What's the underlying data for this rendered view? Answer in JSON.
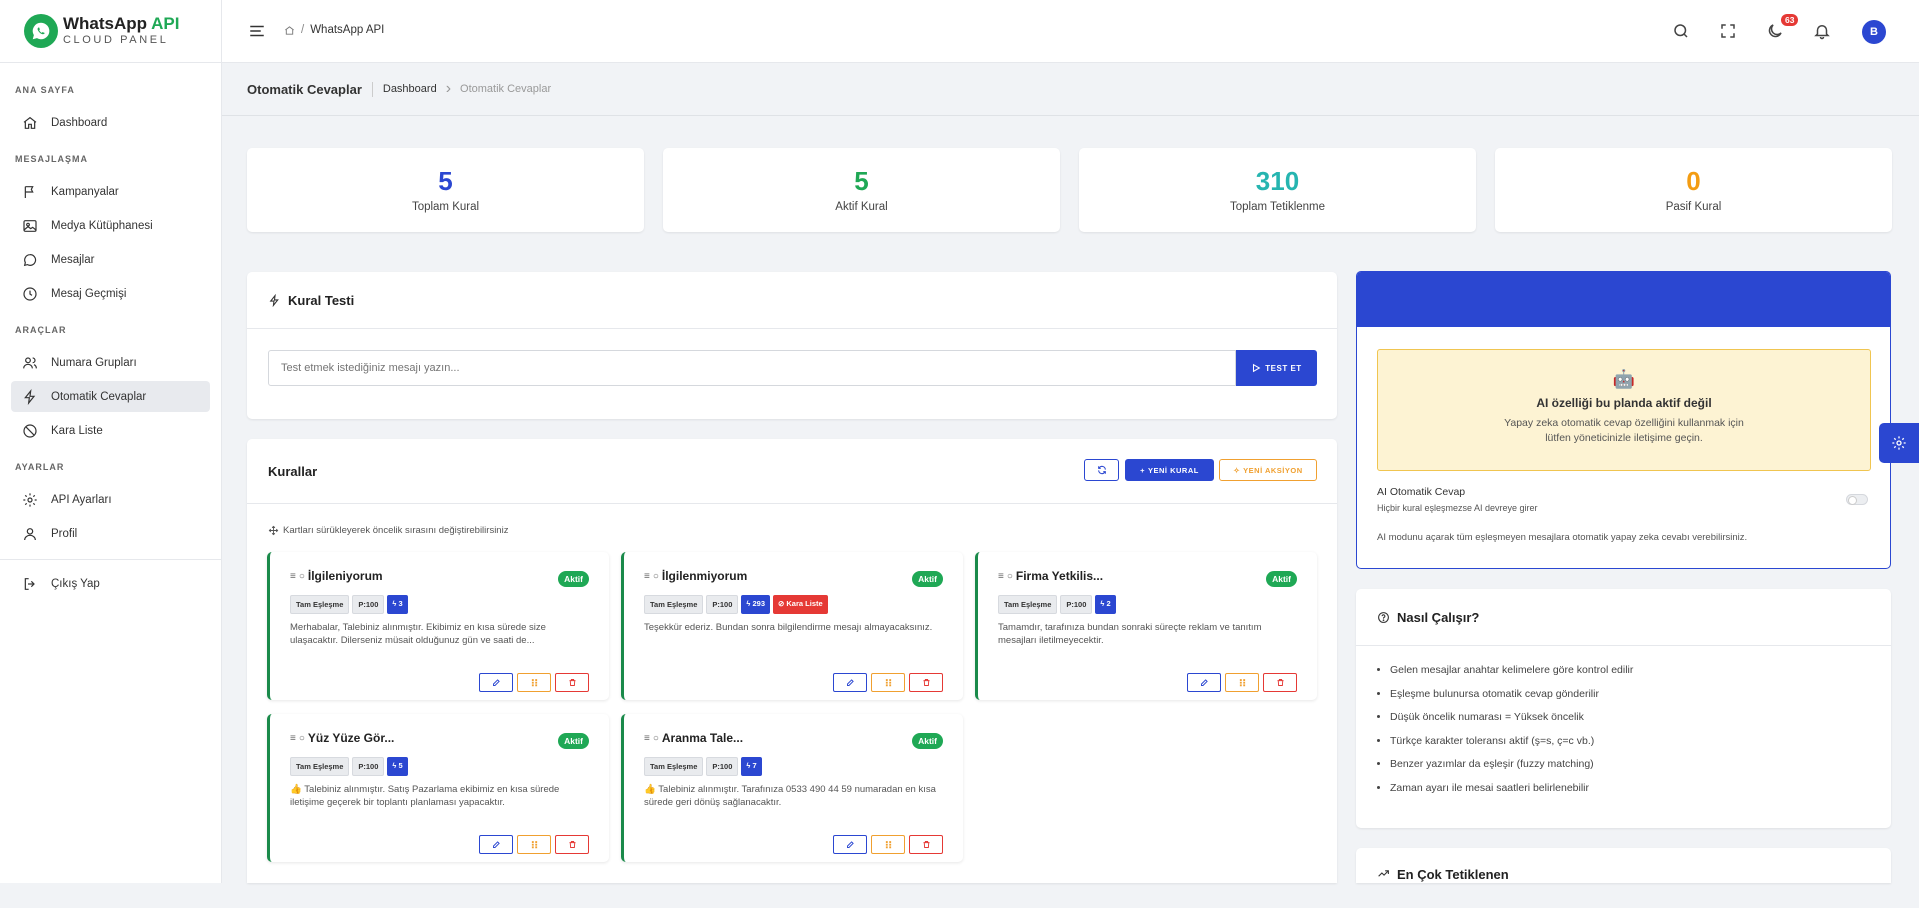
{
  "brand": {
    "title": "WhatsApp",
    "title_accent": "API",
    "subtitle": "CLOUD PANEL"
  },
  "sidebar": {
    "sections": [
      {
        "title": "ANA SAYFA",
        "items": [
          {
            "label": "Dashboard",
            "icon": "home-icon"
          }
        ]
      },
      {
        "title": "MESAJLAŞMA",
        "items": [
          {
            "label": "Kampanyalar",
            "icon": "flag-icon"
          },
          {
            "label": "Medya Kütüphanesi",
            "icon": "image-icon"
          },
          {
            "label": "Mesajlar",
            "icon": "chat-icon"
          },
          {
            "label": "Mesaj Geçmişi",
            "icon": "clock-icon"
          }
        ]
      },
      {
        "title": "ARAÇLAR",
        "items": [
          {
            "label": "Numara Grupları",
            "icon": "users-icon"
          },
          {
            "label": "Otomatik Cevaplar",
            "icon": "bolt-icon",
            "active": true
          },
          {
            "label": "Kara Liste",
            "icon": "ban-icon"
          }
        ]
      },
      {
        "title": "AYARLAR",
        "items": [
          {
            "label": "API Ayarları",
            "icon": "gear-icon"
          },
          {
            "label": "Profil",
            "icon": "user-icon"
          }
        ]
      }
    ],
    "logout": "Çıkış Yap"
  },
  "topbar": {
    "breadcrumb": "WhatsApp API",
    "notification_count": "63",
    "avatar_initial": "B"
  },
  "page": {
    "title": "Otomatik Cevaplar",
    "crumb_root": "Dashboard",
    "crumb_current": "Otomatik Cevaplar"
  },
  "stats": [
    {
      "value": "5",
      "label": "Toplam Kural",
      "color": "#2b47d1"
    },
    {
      "value": "5",
      "label": "Aktif Kural",
      "color": "#1fa855"
    },
    {
      "value": "310",
      "label": "Toplam Tetiklenme",
      "color": "#26b5b0"
    },
    {
      "value": "0",
      "label": "Pasif Kural",
      "color": "#f39c12"
    }
  ],
  "rule_test": {
    "title": "Kural Testi",
    "placeholder": "Test etmek istediğiniz mesajı yazın...",
    "button": "TEST ET"
  },
  "rules_panel": {
    "title": "Kurallar",
    "new_rule": "YENİ KURAL",
    "new_action": "YENİ AKSİYON",
    "hint": "Kartları sürükleyerek öncelik sırasını değiştirebilirsiniz"
  },
  "rules": [
    {
      "title": "İlgileniyorum",
      "status": "Aktif",
      "match": "Tam Eşleşme",
      "priority": "P:100",
      "count": "3",
      "text": "Merhabalar, Talebiniz alınmıştır. Ekibimiz en kısa sürede size ulaşacaktır. Dilerseniz müsait olduğunuz gün ve saati de..."
    },
    {
      "title": "İlgilenmiyorum",
      "status": "Aktif",
      "match": "Tam Eşleşme",
      "priority": "P:100",
      "count": "293",
      "blacklist": "Kara Liste",
      "text": "Teşekkür ederiz. Bundan sonra bilgilendirme mesajı almayacaksınız."
    },
    {
      "title": "Firma Yetkilis...",
      "status": "Aktif",
      "match": "Tam Eşleşme",
      "priority": "P:100",
      "count": "2",
      "text": "Tamamdır, tarafınıza bundan sonraki süreçte reklam ve tanıtım mesajları iletilmeyecektir."
    },
    {
      "title": "Yüz Yüze Gör...",
      "status": "Aktif",
      "match": "Tam Eşleşme",
      "priority": "P:100",
      "count": "5",
      "text": "👍 Talebiniz alınmıştır. Satış Pazarlama ekibimiz en kısa sürede iletişime geçerek bir toplantı planlaması yapacaktır."
    },
    {
      "title": "Aranma Tale...",
      "status": "Aktif",
      "match": "Tam Eşleşme",
      "priority": "P:100",
      "count": "7",
      "text": "👍 Talebiniz alınmıştır. Tarafınıza 0533 490 44 59 numaradan en kısa sürede geri dönüş sağlanacaktır."
    }
  ],
  "ai": {
    "emoji": "🤖",
    "warn_title": "AI özelliği bu planda aktif değil",
    "warn_line1": "Yapay zeka otomatik cevap özelliğini kullanmak için",
    "warn_line2": "lütfen yöneticinizle iletişime geçin.",
    "label": "AI Otomatik Cevap",
    "sublabel": "Hiçbir kural eşleşmezse AI devreye girer",
    "desc": "AI modunu açarak tüm eşleşmeyen mesajlara otomatik yapay zeka cevabı verebilirsiniz."
  },
  "how": {
    "title": "Nasıl Çalışır?",
    "items": [
      "Gelen mesajlar anahtar kelimelere göre kontrol edilir",
      "Eşleşme bulunursa otomatik cevap gönderilir",
      "Düşük öncelik numarası = Yüksek öncelik",
      "Türkçe karakter toleransı aktif (ş=s, ç=c vb.)",
      "Benzer yazımlar da eşleşir (fuzzy matching)",
      "Zaman ayarı ile mesai saatleri belirlenebilir"
    ]
  },
  "top": {
    "title": "En Çok Tetiklenen"
  }
}
